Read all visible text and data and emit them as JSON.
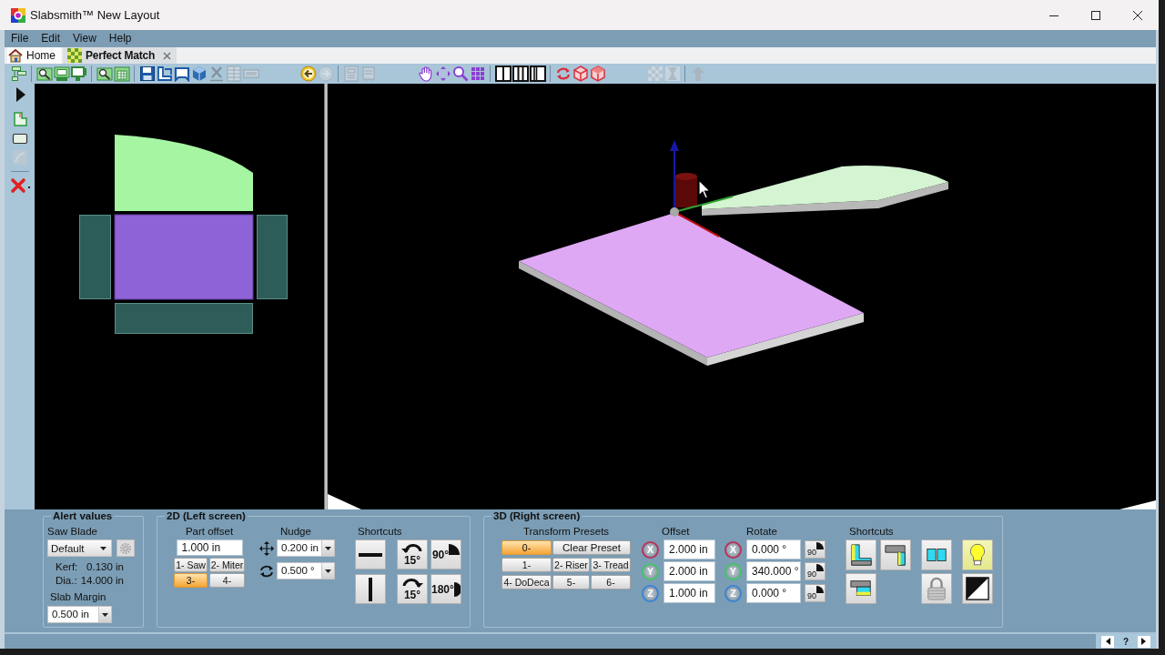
{
  "window": {
    "title": "Slabsmith™ New Layout"
  },
  "menu": [
    {
      "label": "File"
    },
    {
      "label": "Edit"
    },
    {
      "label": "View"
    },
    {
      "label": "Help"
    }
  ],
  "tabs": [
    {
      "label": "Home",
      "kind": "home",
      "selected": false,
      "closable": false
    },
    {
      "label": "Perfect Match",
      "kind": "match",
      "selected": true,
      "closable": true
    }
  ],
  "toolbar": [
    {
      "divider": false,
      "items": [
        {
          "kind": "layout",
          "disabled": false
        }
      ]
    },
    {
      "divider": true,
      "items": [
        {
          "kind": "findslab",
          "disabled": false
        },
        {
          "kind": "sheet",
          "disabled": false
        },
        {
          "kind": "screen",
          "disabled": false
        }
      ]
    },
    {
      "divider": true,
      "items": [
        {
          "kind": "findslab",
          "disabled": false
        },
        {
          "kind": "calc",
          "disabled": false
        }
      ]
    },
    {
      "divider": true,
      "items": [
        {
          "kind": "save",
          "disabled": false
        },
        {
          "kind": "pages",
          "disabled": false
        },
        {
          "kind": "frame",
          "disabled": false
        },
        {
          "kind": "cube",
          "disabled": false
        },
        {
          "kind": "excel",
          "disabled": true
        },
        {
          "kind": "grid",
          "disabled": true
        },
        {
          "kind": "barcode",
          "disabled": true
        }
      ]
    },
    {
      "divider": false,
      "items": [
        {
          "kind": "back",
          "disabled": false
        },
        {
          "kind": "forward",
          "disabled": true
        }
      ]
    },
    {
      "divider": true,
      "items": [
        {
          "kind": "doc",
          "disabled": true
        },
        {
          "kind": "doc2",
          "disabled": true
        }
      ]
    },
    {
      "divider": false,
      "items": [
        {
          "kind": "hand",
          "disabled": false
        },
        {
          "kind": "move",
          "disabled": false
        },
        {
          "kind": "zoom",
          "disabled": false
        },
        {
          "kind": "tiles",
          "disabled": false
        }
      ]
    },
    {
      "divider": true,
      "items": [
        {
          "kind": "panes1",
          "disabled": false
        },
        {
          "kind": "panes2",
          "disabled": false
        },
        {
          "kind": "panes3",
          "disabled": false
        }
      ]
    },
    {
      "divider": true,
      "items": [
        {
          "kind": "rotate",
          "disabled": false
        },
        {
          "kind": "box",
          "disabled": false
        },
        {
          "kind": "box2",
          "disabled": false
        }
      ]
    },
    {
      "divider": false,
      "items": [
        {
          "kind": "checker",
          "disabled": true
        },
        {
          "kind": "mirror",
          "disabled": true
        }
      ]
    },
    {
      "divider": true,
      "items": [
        {
          "kind": "up",
          "disabled": true
        }
      ]
    }
  ],
  "side_tools": [
    {
      "items": [
        {
          "kind": "play",
          "disabled": false
        },
        {
          "kind": "part",
          "disabled": false
        },
        {
          "kind": "rect",
          "disabled": false
        },
        {
          "kind": "image",
          "disabled": true
        }
      ]
    },
    {
      "items": [
        {
          "kind": "delete",
          "disabled": false
        }
      ]
    }
  ],
  "alert_values": {
    "title": "Alert values",
    "saw_blade_label": "Saw Blade",
    "saw_blade": "Default",
    "kerf_label": "Kerf:",
    "kerf": "0.130 in",
    "dia_label": "Dia.:",
    "dia": "14.000 in",
    "slab_margin_label": "Slab Margin",
    "slab_margin": "0.500 in"
  },
  "panel_2d": {
    "title": "2D (Left screen)",
    "part_offset_label": "Part offset",
    "part_offset": "1.000 in",
    "presets": [
      {
        "label": "1- Saw",
        "selected": false
      },
      {
        "label": "2- Miter",
        "selected": false
      },
      {
        "label": "3-",
        "selected": true
      },
      {
        "label": "4-",
        "selected": false
      }
    ],
    "nudge_label": "Nudge",
    "nudge_distance": "0.200 in",
    "nudge_angle": "0.500 °",
    "shortcuts_label": "Shortcuts",
    "shortcuts": [
      {
        "kind": "hline"
      },
      {
        "kind": "ccw",
        "label": "15°"
      },
      {
        "kind": "quarter",
        "label": "90°"
      },
      {
        "kind": "vline"
      },
      {
        "kind": "cw",
        "label": "15°"
      },
      {
        "kind": "half",
        "label": "180°"
      }
    ]
  },
  "panel_3d": {
    "title": "3D (Right screen)",
    "presets_label": "Transform Presets",
    "clear_preset": "Clear Preset",
    "presets": [
      {
        "label": "0-",
        "selected": true
      },
      {
        "label": "1-",
        "selected": false
      },
      {
        "label": "2- Riser",
        "selected": false
      },
      {
        "label": "3- Tread",
        "selected": false
      },
      {
        "label": "4- DoDeca",
        "selected": false
      },
      {
        "label": "5-",
        "selected": false
      },
      {
        "label": "6-",
        "selected": false
      }
    ],
    "offset_label": "Offset",
    "offset": [
      {
        "axis": "X",
        "color": "#b8345a",
        "value": "2.000 in"
      },
      {
        "axis": "Y",
        "color": "#46c46c",
        "value": "2.000 in"
      },
      {
        "axis": "Z",
        "color": "#3c84d4",
        "value": "1.000 in"
      }
    ],
    "rotate_label": "Rotate",
    "rotate": [
      {
        "axis": "X",
        "color": "#b8345a",
        "value": "0.000 °",
        "step": "90"
      },
      {
        "axis": "Y",
        "color": "#46c46c",
        "value": "340.000 °",
        "step": "90"
      },
      {
        "axis": "Z",
        "color": "#3c84d4",
        "value": "0.000 °",
        "step": "90"
      }
    ],
    "shortcuts_label": "Shortcuts",
    "shortcuts": [
      {
        "kind": "lshape"
      },
      {
        "kind": "corner"
      },
      {
        "kind": "pair"
      },
      {
        "kind": "bulb"
      },
      {
        "kind": "stack"
      },
      {
        "kind": "lock"
      },
      {
        "kind": "contrast"
      }
    ]
  },
  "status_bar": {
    "help": "?"
  }
}
